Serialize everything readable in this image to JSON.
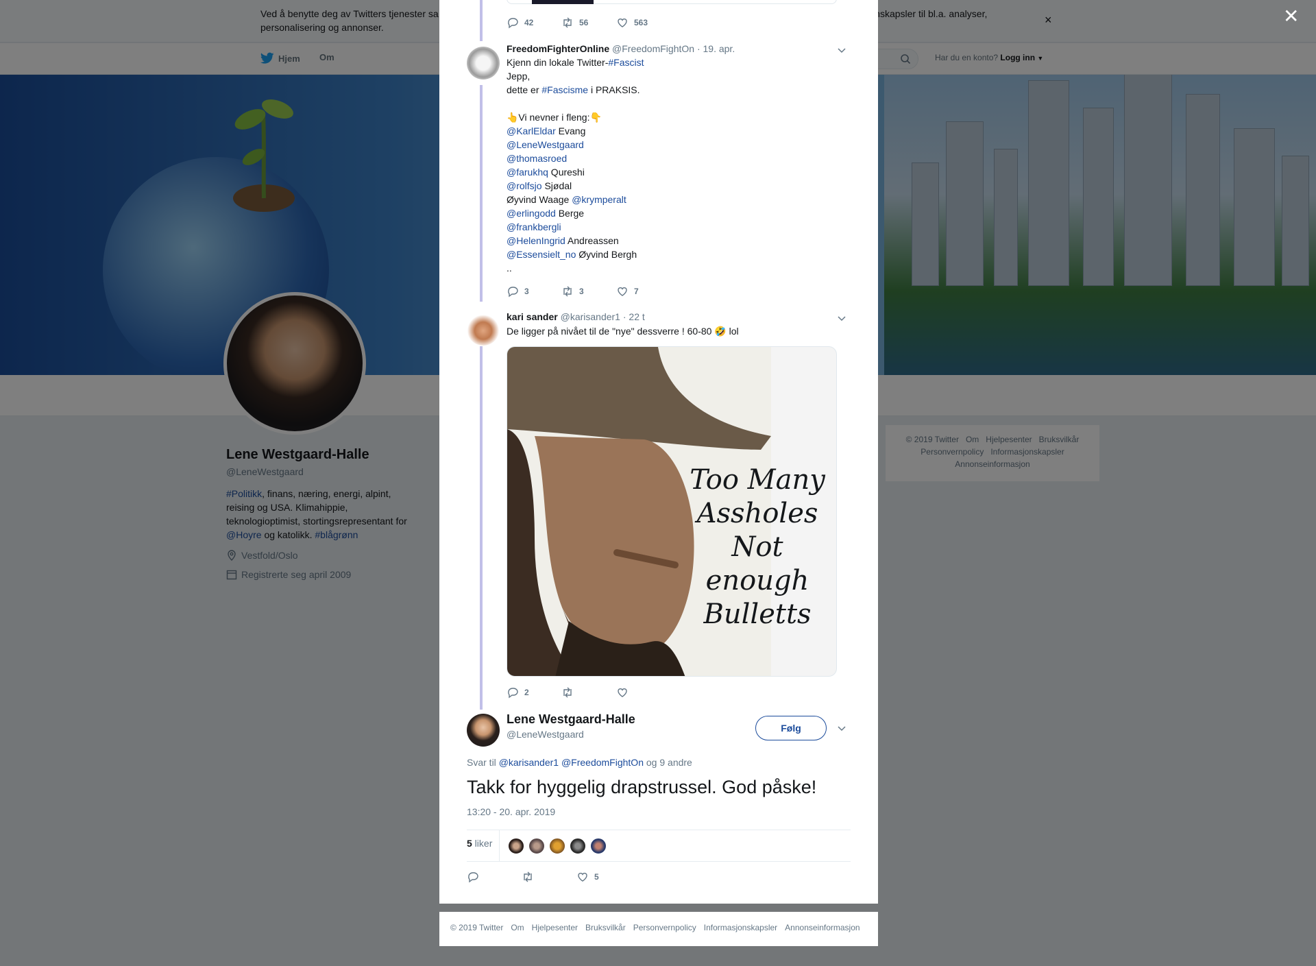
{
  "cookie": {
    "text_left": "Ved å benytte deg av Twitters tjenester sa",
    "text_right": "informasjonskapsler til bl.a. analyser,",
    "text_line2": "personalisering og annonser.",
    "close": "×"
  },
  "nav": {
    "home": "Hjem",
    "about": "Om",
    "login_prompt": "Har du en konto?",
    "login": "Logg inn"
  },
  "profile": {
    "name": "Lene Westgaard-Halle",
    "handle": "@LeneWestgaard",
    "bio_tag1": "#Politikk",
    "bio_text1": ", finans, næring, energi, alpint, reising og USA. Klimahippie, teknologioptimist, stortingsrepresentant for ",
    "bio_mention": "@Hoyre",
    "bio_text2": " og katolikk. ",
    "bio_tag2": "#blågrønn",
    "location": "Vestfold/Oslo",
    "joined": "Registrerte seg april 2009"
  },
  "side_footer": {
    "links": [
      "© 2019 Twitter",
      "Om",
      "Hjelpesenter",
      "Bruksvilkår",
      "Personvernpolicy",
      "Informasjonskapsler",
      "Annonseinformasjon"
    ]
  },
  "overlay": {
    "close": "✕"
  },
  "tweets": [
    {
      "replies": "42",
      "retweets": "56",
      "likes": "563"
    },
    {
      "name": "FreedomFighterOnline",
      "handle": "@FreedomFightOn",
      "time": "· 19. apr.",
      "lines": [
        {
          "t": "Kjenn din lokale Twitter-",
          "l": "#Fascist"
        },
        {
          "t": "Jepp,"
        },
        {
          "t": "dette er ",
          "l": "#Fascisme",
          "a": " i PRAKSIS."
        },
        {
          "t": ""
        },
        {
          "t": "👆Vi nevner i fleng:👇"
        },
        {
          "l": "@KarlEldar",
          "a": " Evang"
        },
        {
          "l": "@LeneWestgaard"
        },
        {
          "l": "@thomasroed"
        },
        {
          "l": "@farukhq",
          "a": " Qureshi"
        },
        {
          "l": "@rolfsjo",
          "a": " Sjødal"
        },
        {
          "t": "Øyvind Waage ",
          "l": "@krymperalt"
        },
        {
          "l": "@erlingodd",
          "a": " Berge"
        },
        {
          "l": "@frankbergli"
        },
        {
          "l": "@HelenIngrid",
          "a": " Andreassen"
        },
        {
          "l": "@Essensielt_no",
          "a": " Øyvind Bergh"
        },
        {
          "t": ".."
        }
      ],
      "replies": "3",
      "retweets": "3",
      "likes": "7"
    },
    {
      "name": "kari sander",
      "handle": "@karisander1",
      "time": "· 22 t",
      "text": "De ligger på nivået til de \"nye\" dessverre ! 60-80 🤣 lol",
      "image_text": [
        "Too Many",
        "Assholes",
        "Not enough",
        "Bulletts"
      ],
      "replies": "2",
      "retweets": "",
      "likes": ""
    }
  ],
  "main_tweet": {
    "name": "Lene Westgaard-Halle",
    "handle": "@LeneWestgaard",
    "follow": "Følg",
    "reply_to_label": "Svar til ",
    "reply_to_1": "@karisander1",
    "reply_to_2": "@FreedomFightOn",
    "reply_to_rest": " og 9 andre",
    "text": "Takk for hyggelig drapstrussel. God påske!",
    "timestamp": "13:20 - 20. apr. 2019",
    "likes_count": "5",
    "likes_label": " liker",
    "replies": "",
    "retweets": "",
    "likes": "5"
  },
  "modal_footer": {
    "links": [
      "© 2019 Twitter",
      "Om",
      "Hjelpesenter",
      "Bruksvilkår",
      "Personvernpolicy",
      "Informasjonskapsler",
      "Annonseinformasjon"
    ]
  },
  "colors": {
    "link": "#1b4b9b",
    "thread_line": "#c1bfe8",
    "text": "#14171a",
    "muted": "#657786"
  },
  "icons": [
    "twitter-bird-icon",
    "search-icon",
    "caret-down-icon",
    "location-icon",
    "calendar-icon",
    "reply-icon",
    "retweet-icon",
    "like-icon",
    "chevron-down-icon",
    "close-icon"
  ]
}
